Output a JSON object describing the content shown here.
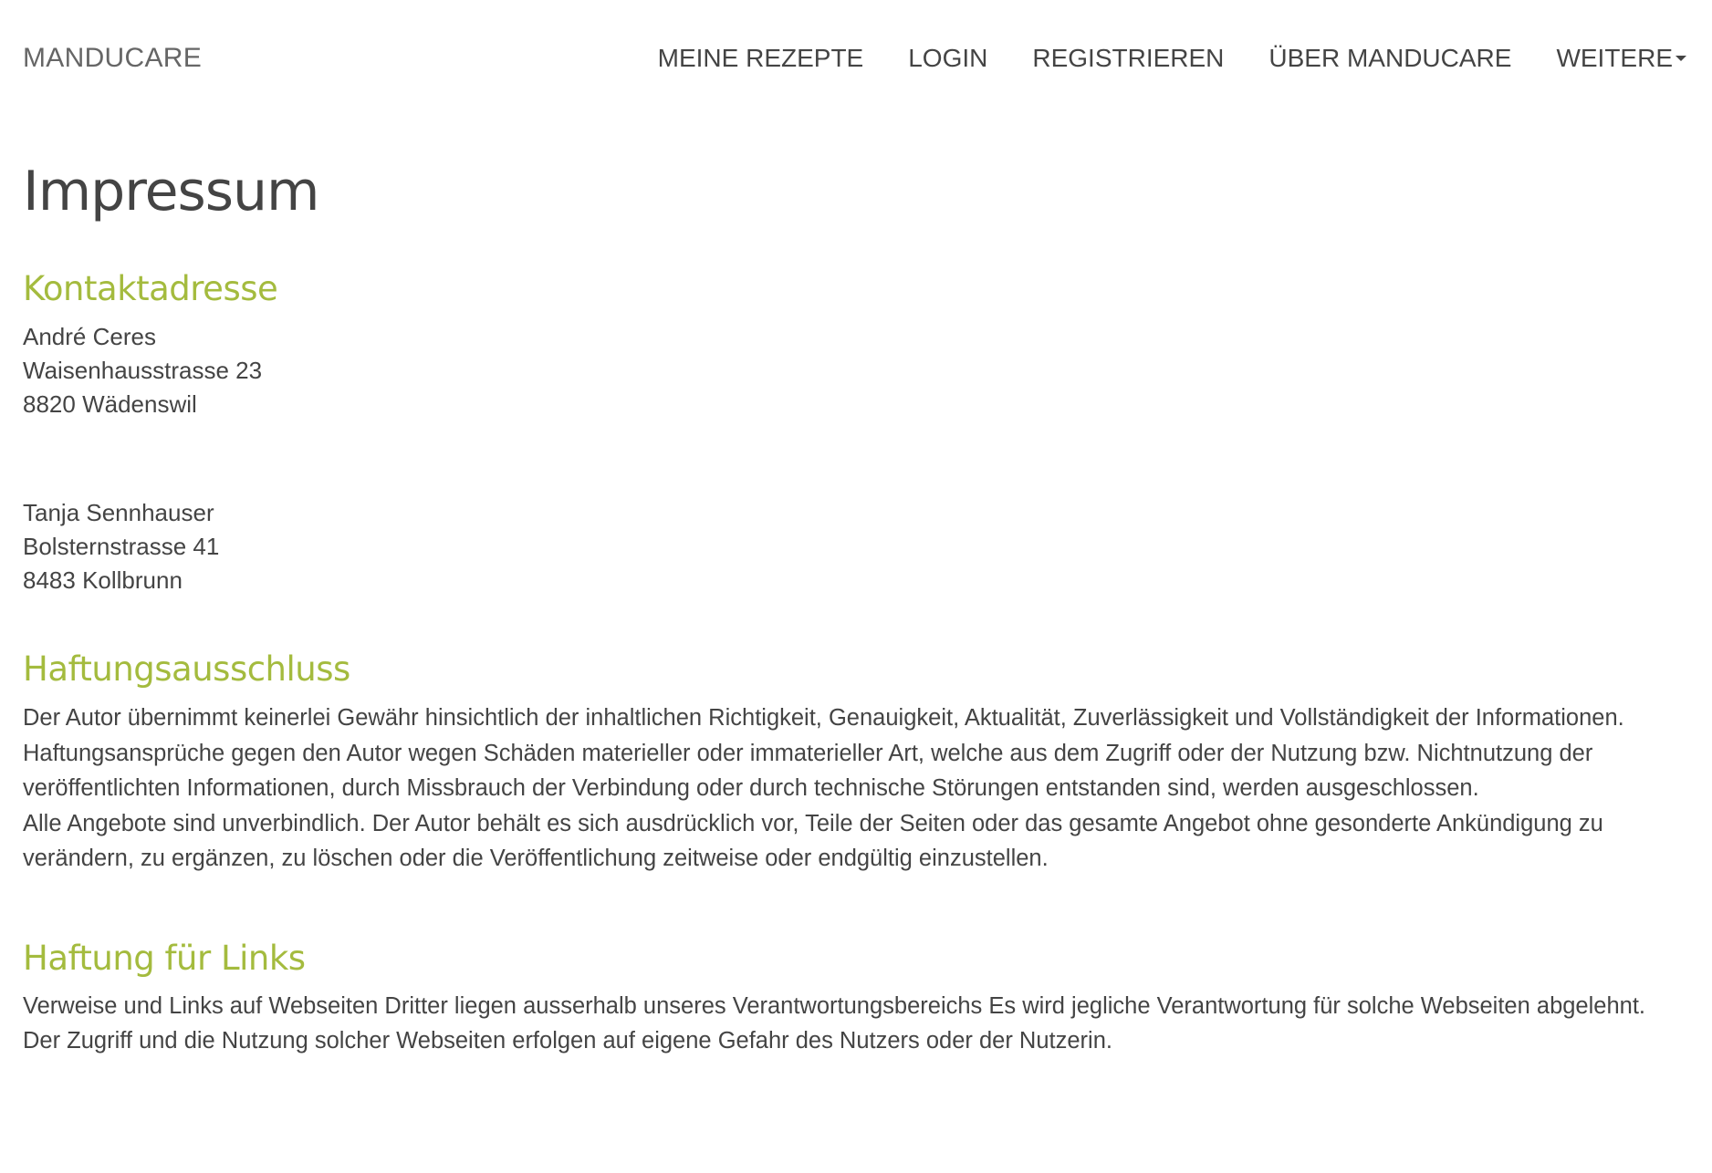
{
  "navbar": {
    "brand": "MANDUCARE",
    "links": [
      {
        "label": "MEINE REZEPTE"
      },
      {
        "label": "LOGIN"
      },
      {
        "label": "REGISTRIEREN"
      },
      {
        "label": "ÜBER MANDUCARE"
      },
      {
        "label": "WEITERE"
      }
    ]
  },
  "page": {
    "title": "Impressum"
  },
  "kontakt": {
    "title": "Kontaktadresse",
    "address1": {
      "name": "André Ceres",
      "street": "Waisenhausstrasse 23",
      "city": "8820 Wädenswil"
    },
    "address2": {
      "name": "Tanja Sennhauser",
      "street": "Bolsternstrasse 41",
      "city": "8483 Kollbrunn"
    }
  },
  "haftungsausschluss": {
    "title": "Haftungsausschluss",
    "lines": [
      "Der Autor übernimmt keinerlei Gewähr hinsichtlich der inhaltlichen Richtigkeit, Genauigkeit, Aktualität, Zuverlässigkeit und Vollständigkeit der Informationen.",
      "Haftungsansprüche gegen den Autor wegen Schäden materieller oder immaterieller Art, welche aus dem Zugriff oder der Nutzung bzw. Nichtnutzung der",
      "veröffentlichten Informationen, durch Missbrauch der Verbindung oder durch technische Störungen entstanden sind, werden ausgeschlossen.",
      "Alle Angebote sind unverbindlich. Der Autor behält es sich ausdrücklich vor, Teile der Seiten oder das gesamte Angebot ohne gesonderte Ankündigung zu",
      "verändern, zu ergänzen, zu löschen oder die Veröffentlichung zeitweise oder endgültig einzustellen."
    ]
  },
  "haftung_links": {
    "title": "Haftung für Links",
    "lines": [
      "Verweise und Links auf Webseiten Dritter liegen ausserhalb unseres Verantwortungsbereichs Es wird jegliche Verantwortung für solche Webseiten abgelehnt.",
      "Der Zugriff und die Nutzung solcher Webseiten erfolgen auf eigene Gefahr des Nutzers oder der Nutzerin."
    ]
  },
  "colors": {
    "accent": "#a4bb3e",
    "text": "#444444",
    "brand": "#666666"
  }
}
